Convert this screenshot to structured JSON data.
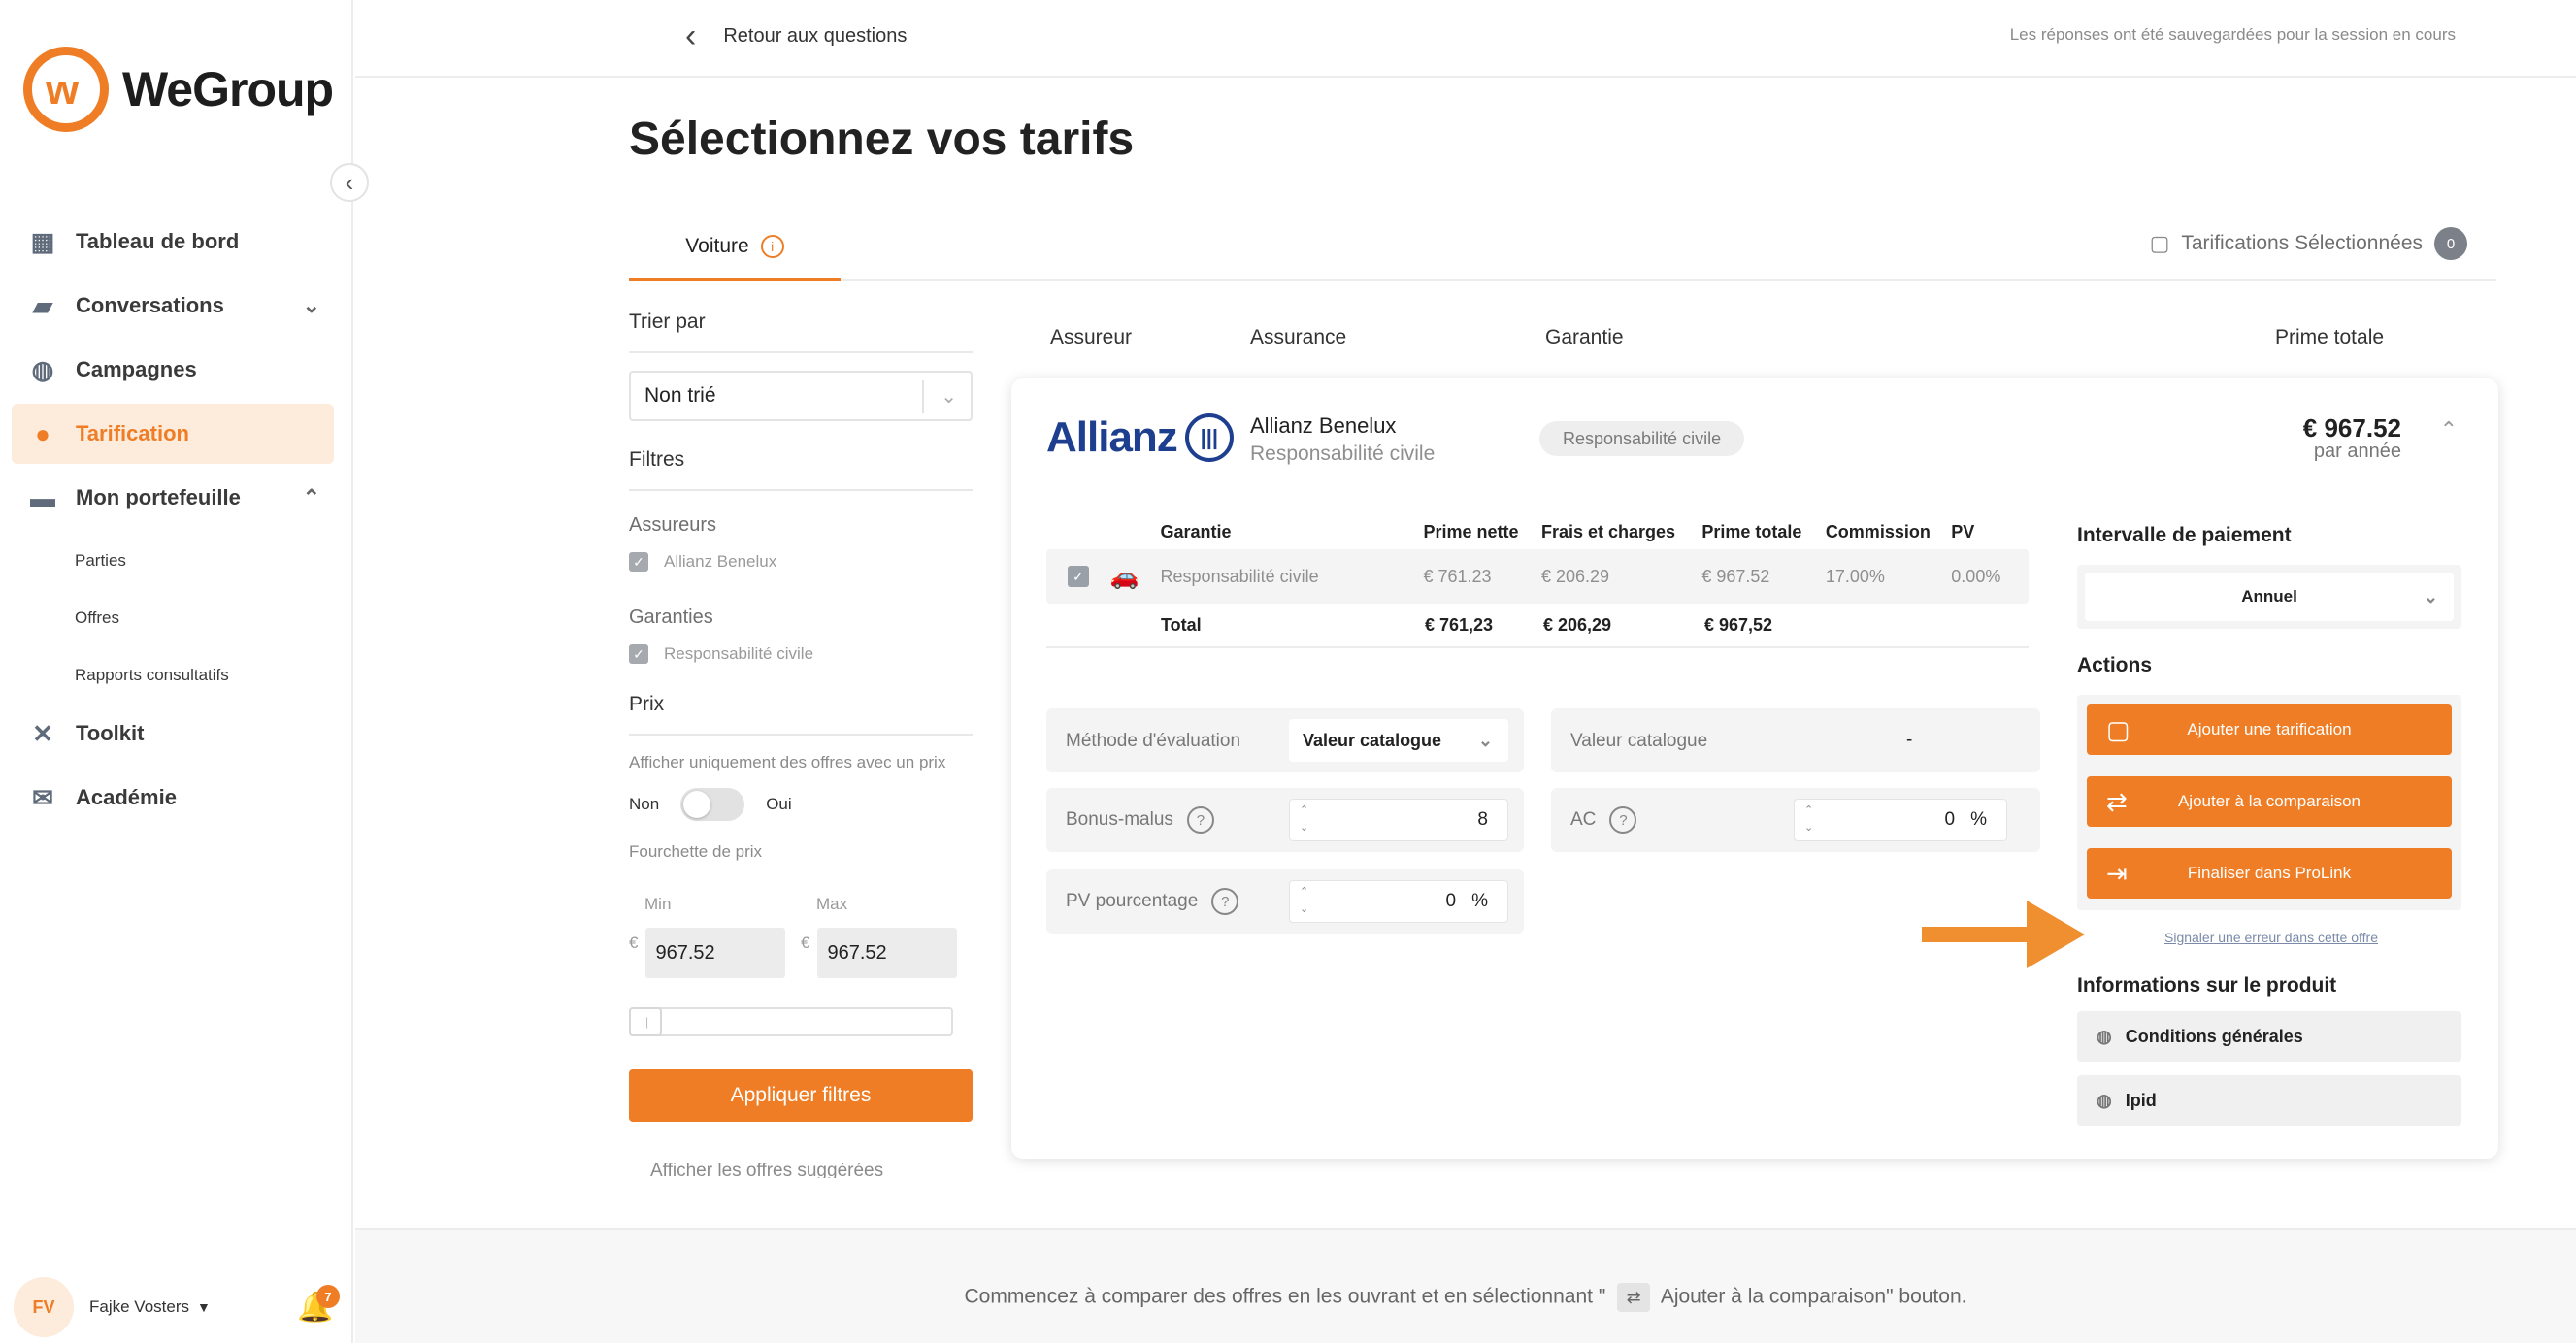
{
  "sidebar": {
    "brand": "WeGroup",
    "items": [
      {
        "label": "Tableau de bord",
        "icon": "dashboard-icon"
      },
      {
        "label": "Conversations",
        "icon": "chat-icon"
      },
      {
        "label": "Campagnes",
        "icon": "globe-icon"
      },
      {
        "label": "Tarification",
        "icon": "piggy-bank-icon",
        "active": true
      },
      {
        "label": "Mon portefeuille",
        "icon": "folder-icon"
      },
      {
        "label": "Toolkit",
        "icon": "tools-icon"
      },
      {
        "label": "Académie",
        "icon": "mail-icon"
      }
    ],
    "sub_items": [
      "Parties",
      "Offres",
      "Rapports consultatifs"
    ],
    "user": {
      "initials": "FV",
      "name": "Fajke Vosters",
      "notifications": "7"
    }
  },
  "topbar": {
    "back_label": "Retour aux questions",
    "saved_note": "Les réponses ont été sauvegardées pour la session en cours"
  },
  "page": {
    "title": "Sélectionnez vos tarifs",
    "tab": "Voiture",
    "selected_label": "Tarifications Sélectionnées",
    "selected_count": "0"
  },
  "filters": {
    "sort_label": "Trier par",
    "sort_value": "Non trié",
    "filters_label": "Filtres",
    "insurers_label": "Assureurs",
    "insurer_option": "Allianz Benelux",
    "guarantees_label": "Garanties",
    "guarantee_option": "Responsabilité civile",
    "price_label": "Prix",
    "price_desc": "Afficher uniquement des offres avec un prix",
    "toggle_off": "Non",
    "toggle_on": "Oui",
    "range_label": "Fourchette de prix",
    "min_label": "Min",
    "max_label": "Max",
    "currency": "€",
    "min_value": "967.52",
    "max_value": "967.52",
    "apply_label": "Appliquer filtres",
    "more_label": "Afficher les offres suggérées"
  },
  "results": {
    "headers": {
      "insurer": "Assureur",
      "insurance": "Assurance",
      "guarantee": "Garantie",
      "total": "Prime totale"
    },
    "offer": {
      "logo_word": "Allianz",
      "insurer": "Allianz Benelux",
      "product": "Responsabilité civile",
      "cover_pill": "Responsabilité civile",
      "price": "€ 967.52",
      "period": "par année",
      "table": {
        "headers": [
          "Garantie",
          "Prime nette",
          "Frais et charges",
          "Prime totale",
          "Commission",
          "PV"
        ],
        "row": [
          "Responsabilité civile",
          "€ 761.23",
          "€ 206.29",
          "€ 967.52",
          "17.00%",
          "0.00%"
        ],
        "total": [
          "Total",
          "€ 761,23",
          "€ 206,29",
          "€ 967,52"
        ]
      },
      "params": {
        "method_label": "Méthode d'évaluation",
        "method_value": "Valeur catalogue",
        "catalog_label": "Valeur catalogue",
        "catalog_value": "-",
        "bonus_label": "Bonus-malus",
        "bonus_value": "8",
        "ac_label": "AC",
        "ac_value": "0",
        "pv_label": "PV pourcentage",
        "pv_value": "0",
        "percent": "%"
      },
      "side": {
        "payment_label": "Intervalle de paiement",
        "payment_value": "Annuel",
        "actions_label": "Actions",
        "action_add_tarif": "Ajouter une tarification",
        "action_add_compare": "Ajouter à la comparaison",
        "action_finalize": "Finaliser dans ProLink",
        "report_link": "Signaler une erreur dans cette offre",
        "info_label": "Informations sur le produit",
        "info_conditions": "Conditions générales",
        "info_ipid": "Ipid"
      }
    }
  },
  "bottom": {
    "text_before": "Commencez à comparer des offres en les ouvrant et en sélectionnant \"",
    "text_after": "Ajouter à la comparaison\" bouton."
  },
  "colors": {
    "accent": "#ef7d25",
    "allianz": "#1e3f8f"
  }
}
